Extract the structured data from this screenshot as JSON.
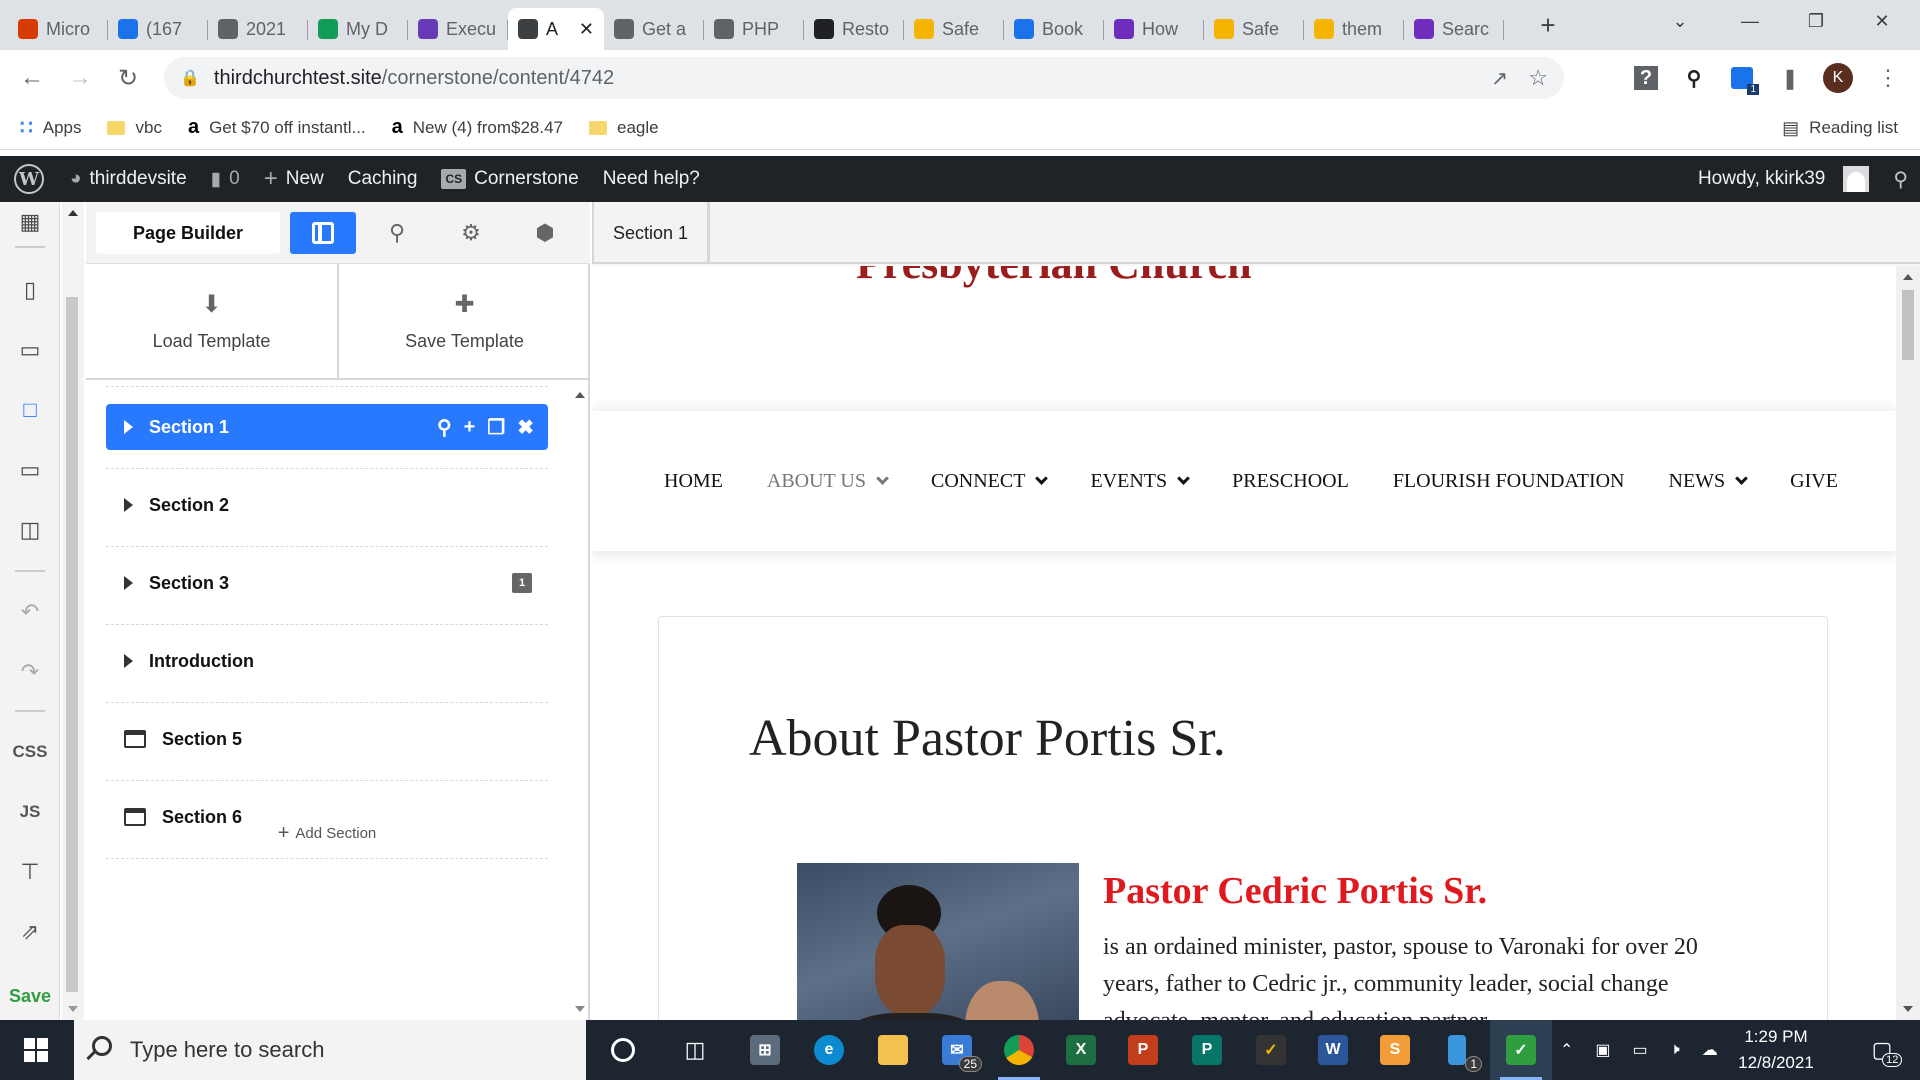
{
  "browser": {
    "tabs": [
      {
        "label": "Micro",
        "icon": "office-icon",
        "color": "#d83b01"
      },
      {
        "label": "(167",
        "icon": "stack-icon",
        "color": "#1a73e8"
      },
      {
        "label": "2021",
        "icon": "globe-icon",
        "color": "#5f6368"
      },
      {
        "label": "My D",
        "icon": "drive-icon",
        "color": "#0f9d58"
      },
      {
        "label": "Execu",
        "icon": "forms-icon",
        "color": "#673ab7"
      },
      {
        "label": "A",
        "icon": "wordpress-icon",
        "color": "#3c4043",
        "active": true
      },
      {
        "label": "Get a",
        "icon": "wordpress-icon",
        "color": "#5f6368"
      },
      {
        "label": "PHP",
        "icon": "wordpress-icon",
        "color": "#5f6368"
      },
      {
        "label": "Resto",
        "icon": "shield-icon",
        "color": "#202124"
      },
      {
        "label": "Safe",
        "icon": "norton-check-icon",
        "color": "#f4b400"
      },
      {
        "label": "Book",
        "icon": "star-icon",
        "color": "#1a73e8"
      },
      {
        "label": "How",
        "icon": "t-circle-icon",
        "color": "#6f2dbd"
      },
      {
        "label": "Safe",
        "icon": "norton-check-icon",
        "color": "#f4b400"
      },
      {
        "label": "them",
        "icon": "norton-check-icon",
        "color": "#f4b400"
      },
      {
        "label": "Searc",
        "icon": "t-circle-icon",
        "color": "#6f2dbd"
      }
    ],
    "url_domain": "thirdchurchtest.site",
    "url_path": "/cornerstone/content/4742",
    "bookmarks": [
      {
        "label": "Apps",
        "icon": "apps-grid-icon"
      },
      {
        "label": "vbc",
        "icon": "folder-icon"
      },
      {
        "label": "Get $70 off instantl...",
        "icon": "amazon-icon"
      },
      {
        "label": "New (4) from$28.47",
        "icon": "amazon-icon"
      },
      {
        "label": "eagle",
        "icon": "folder-icon"
      }
    ],
    "reading_list": "Reading list",
    "profile_initial": "K",
    "ext_badge": "1"
  },
  "wpbar": {
    "site": "thirddevsite",
    "comments": "0",
    "new": "New",
    "caching": "Caching",
    "cs_badge": "CS",
    "cornerstone": "Cornerstone",
    "help": "Need help?",
    "howdy": "Howdy, kkirk39"
  },
  "builder": {
    "page_builder_tab": "Page Builder",
    "load_template": "Load Template",
    "save_template": "Save Template",
    "breadcrumb": "Section 1",
    "css": "CSS",
    "js": "JS",
    "save": "Save",
    "sections": [
      {
        "label": "Section 1",
        "active": true,
        "type": "caret"
      },
      {
        "label": "Section 2",
        "type": "caret"
      },
      {
        "label": "Section 3",
        "type": "caret",
        "badge": "1"
      },
      {
        "label": "Introduction",
        "type": "caret"
      },
      {
        "label": "Section 5",
        "type": "box"
      },
      {
        "label": "Section 6",
        "type": "box"
      }
    ],
    "add_section": "Add Section"
  },
  "site": {
    "church_name": "Presbyterian Church",
    "nav": [
      {
        "label": "HOME",
        "dropdown": false
      },
      {
        "label": "ABOUT US",
        "dropdown": true,
        "dim": true
      },
      {
        "label": "CONNECT",
        "dropdown": true
      },
      {
        "label": "EVENTS",
        "dropdown": true
      },
      {
        "label": "PRESCHOOL",
        "dropdown": false
      },
      {
        "label": "FLOURISH FOUNDATION",
        "dropdown": false
      },
      {
        "label": "NEWS",
        "dropdown": true
      },
      {
        "label": "GIVE",
        "dropdown": false
      }
    ],
    "heading": "About Pastor Portis Sr.",
    "pastor_name": "Pastor Cedric Portis Sr.",
    "bio": " is an ordained minister, pastor, spouse to Varonaki for over 20 years, father to Cedric jr.,  community leader, social change advocate, mentor, and education partner"
  },
  "taskbar": {
    "search_placeholder": "Type here to search",
    "mail_badge": "25",
    "phone_badge": "1",
    "time": "1:29 PM",
    "date": "12/8/2021",
    "notif_count": "12"
  }
}
